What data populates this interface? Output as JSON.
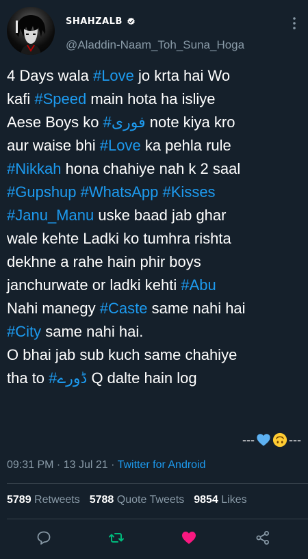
{
  "author": {
    "display_name": "SHAHZALB",
    "handle": "@Aladdin-Naam_Toh_Suna_Hoga",
    "verified_icon": "verified-badge-icon"
  },
  "tweet": {
    "lines": [
      [
        {
          "t": "4 Days wala "
        },
        {
          "t": "#Love",
          "tag": true
        },
        {
          "t": " jo krta hai Wo"
        }
      ],
      [
        {
          "t": "kafi "
        },
        {
          "t": "#Speed",
          "tag": true
        },
        {
          "t": " main hota ha isliye"
        }
      ],
      [
        {
          "t": "Aese Boys ko "
        },
        {
          "t": "#فوری",
          "tag": true
        },
        {
          "t": " note kiya kro"
        }
      ],
      [
        {
          "t": "aur waise bhi "
        },
        {
          "t": "#Love",
          "tag": true
        },
        {
          "t": " ka pehla rule"
        }
      ],
      [
        {
          "t": "#Nikkah",
          "tag": true
        },
        {
          "t": " hona chahiye nah k 2 saal"
        }
      ],
      [
        {
          "t": "#Gupshup",
          "tag": true
        },
        {
          "t": " "
        },
        {
          "t": "#WhatsApp",
          "tag": true
        },
        {
          "t": " "
        },
        {
          "t": "#Kisses",
          "tag": true
        }
      ],
      [
        {
          "t": "#Janu_Manu",
          "tag": true
        },
        {
          "t": " uske baad jab ghar"
        }
      ],
      [
        {
          "t": "wale kehte Ladki ko tumhra rishta"
        }
      ],
      [
        {
          "t": "dekhne a rahe hain phir boys"
        }
      ],
      [
        {
          "t": "janchurwate or ladki kehti "
        },
        {
          "t": "#Abu",
          "tag": true
        }
      ],
      [
        {
          "t": "Nahi manegy "
        },
        {
          "t": "#Caste",
          "tag": true
        },
        {
          "t": " same nahi hai"
        }
      ],
      [
        {
          "t": "#City",
          "tag": true
        },
        {
          "t": " same nahi hai."
        }
      ],
      [
        {
          "t": "O bhai jab sub kuch same chahiye"
        }
      ],
      [
        {
          "t": "tha to "
        },
        {
          "t": "#ڈورے",
          "tag": true
        },
        {
          "t": " Q dalte hain log"
        }
      ]
    ],
    "signoff_left": "---",
    "signoff_right": "---",
    "signoff_emojis": [
      "blue-heart-icon",
      "upside-down-face-icon"
    ]
  },
  "meta": {
    "time": "09:31 PM",
    "separator1": " · ",
    "date": "13 Jul 21",
    "separator2": " · ",
    "source": "Twitter for Android"
  },
  "stats": {
    "retweets_count": "5789",
    "retweets_label": " Retweets",
    "quotes_count": "5788",
    "quotes_label": " Quote Tweets",
    "likes_count": "9854",
    "likes_label": " Likes"
  },
  "actions": [
    {
      "name": "reply-icon",
      "color": "#8899a6"
    },
    {
      "name": "retweet-icon",
      "color": "#00ba7c"
    },
    {
      "name": "like-icon",
      "color": "#f91880"
    },
    {
      "name": "share-icon",
      "color": "#8899a6"
    }
  ],
  "colors": {
    "background": "#15202b",
    "link": "#1d9bf0",
    "muted": "#8899a6",
    "divider": "#38444d"
  }
}
